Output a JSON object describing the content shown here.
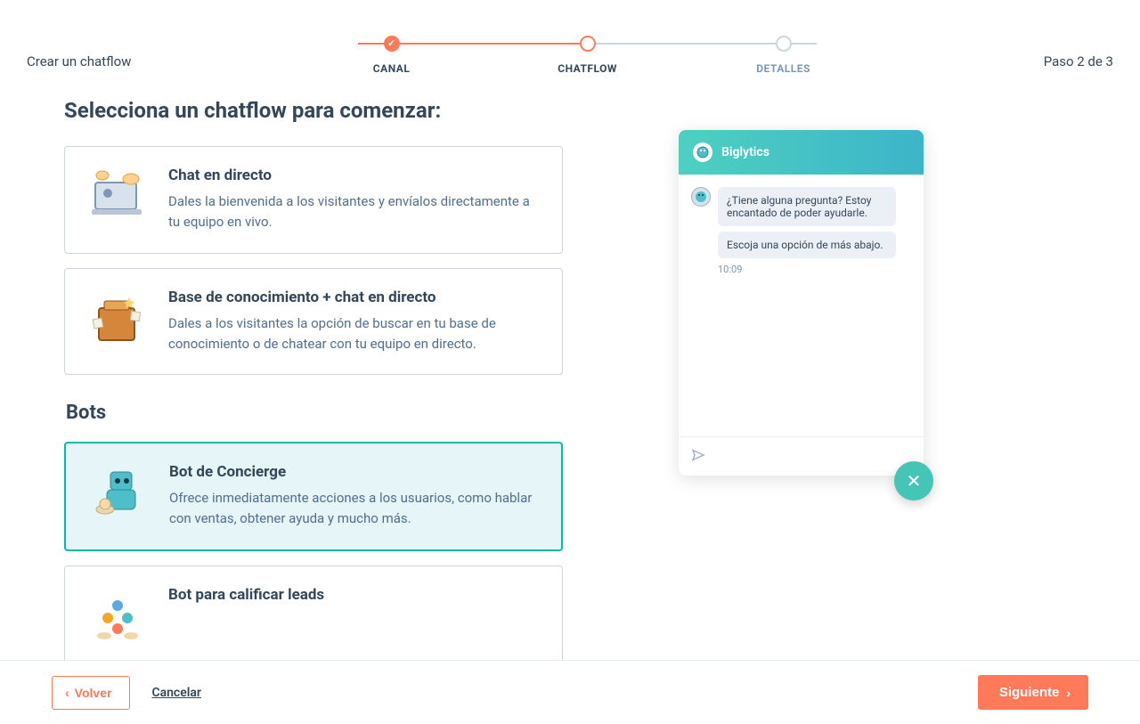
{
  "header": {
    "title": "Crear un chatflow",
    "step_text": "Paso 2 de 3",
    "steps": [
      {
        "label": "CANAL",
        "state": "done"
      },
      {
        "label": "CHATFLOW",
        "state": "current"
      },
      {
        "label": "DETALLES",
        "state": "pending"
      }
    ]
  },
  "section_title": "Selecciona un chatflow para comenzar:",
  "cards": [
    {
      "title": "Chat en directo",
      "desc": "Dales la bienvenida a los visitantes y envíalos directamente a tu equipo en vivo.",
      "selected": false,
      "icon": "laptop-chat-icon"
    },
    {
      "title": "Base de conocimiento + chat en directo",
      "desc": "Dales a los visitantes la opción de buscar en tu base de conocimiento o de chatear con tu equipo en directo.",
      "selected": false,
      "icon": "knowledge-box-icon"
    }
  ],
  "bots_title": "Bots",
  "bot_cards": [
    {
      "title": "Bot de Concierge",
      "desc": "Ofrece inmediatamente acciones a los usuarios, como hablar con ventas, obtener ayuda y mucho más.",
      "selected": true,
      "icon": "concierge-robot-icon"
    },
    {
      "title": "Bot para calificar leads",
      "desc": "",
      "selected": false,
      "icon": "qualify-balls-icon"
    }
  ],
  "chat": {
    "brand": "Biglytics",
    "messages": [
      "¿Tiene alguna pregunta? Estoy encantado de poder ayudarle.",
      "Escoja una opción de más abajo."
    ],
    "time": "10:09"
  },
  "footer": {
    "back": "Volver",
    "cancel": "Cancelar",
    "next": "Siguiente"
  }
}
